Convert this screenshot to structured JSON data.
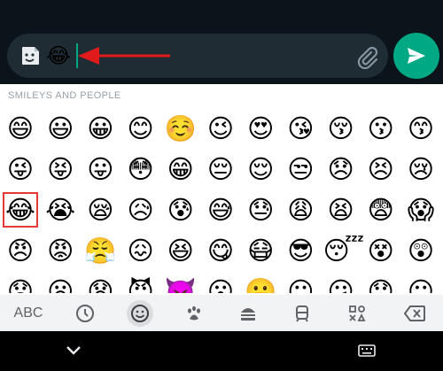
{
  "compose": {
    "typed_text": "😂",
    "sticker_icon": "sticker-icon",
    "attach_icon": "paperclip-icon",
    "send_icon": "send-icon"
  },
  "keyboard": {
    "section_label": "SMILEYS AND PEOPLE",
    "rows": [
      [
        "😄",
        "😃",
        "😀",
        "😊",
        "☺️",
        "😉",
        "😍",
        "😘",
        "😚",
        "😗",
        "😙"
      ],
      [
        "😜",
        "😝",
        "😛",
        "😳",
        "😁",
        "😔",
        "😌",
        "😒",
        "😞",
        "😣",
        "😢"
      ],
      [
        "😂",
        "😭",
        "😪",
        "😥",
        "😰",
        "😅",
        "😓",
        "😩",
        "😫",
        "😨",
        "😱"
      ],
      [
        "😠",
        "😡",
        "😤",
        "😖",
        "😆",
        "😋",
        "😷",
        "😎",
        "😴",
        "😵",
        "😲"
      ],
      [
        "😟",
        "😦",
        "😧",
        "😈",
        "👿",
        "😮",
        "😬",
        "😐",
        "😕",
        "😯",
        "😶"
      ],
      [
        "😇",
        "😏",
        "😑",
        "👲",
        "👳",
        "👮",
        "👷",
        "💂",
        "👶",
        "👦",
        "👧"
      ]
    ],
    "selected": "😂",
    "categories": {
      "abc_label": "ABC",
      "recent_icon": "clock-icon",
      "smileys_icon": "smiley-icon",
      "animals_icon": "paw-icon",
      "food_icon": "burger-icon",
      "travel_icon": "train-icon",
      "symbols_icon": "symbols-icon",
      "backspace_icon": "backspace-icon"
    }
  },
  "nav": {
    "back_icon": "chevron-down-icon",
    "keyboard_icon": "keyboard-icon"
  },
  "colors": {
    "accent": "#00a884",
    "highlight": "#e53935"
  }
}
